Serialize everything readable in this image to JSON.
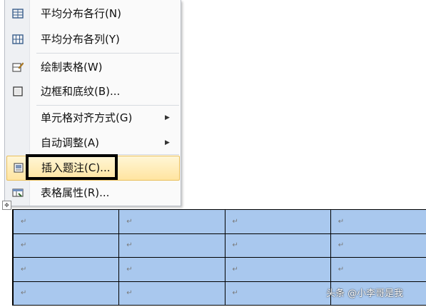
{
  "menu": {
    "items": [
      {
        "label": "平均分布各行(N)",
        "icon": "distribute-rows-icon"
      },
      {
        "label": "平均分布各列(Y)",
        "icon": "distribute-columns-icon"
      },
      {
        "label": "绘制表格(W)",
        "icon": "draw-table-icon"
      },
      {
        "label": "边框和底纹(B)...",
        "icon": "borders-shading-icon"
      },
      {
        "label": "单元格对齐方式(G)",
        "icon": "",
        "submenu": "▶"
      },
      {
        "label": "自动调整(A)",
        "icon": "",
        "submenu": "▶"
      },
      {
        "label": "插入题注(C)...",
        "icon": "insert-caption-icon",
        "highlighted": true
      },
      {
        "label": "表格属性(R)...",
        "icon": "table-properties-icon"
      }
    ]
  },
  "table": {
    "cell_mark": "↵",
    "rows": 4,
    "columns": 4
  },
  "watermark": "头条 @小李哥是我",
  "colors": {
    "cell_fill": "#a9c8ee",
    "highlight": "#ffe4a0",
    "callout_border": "#000000"
  }
}
